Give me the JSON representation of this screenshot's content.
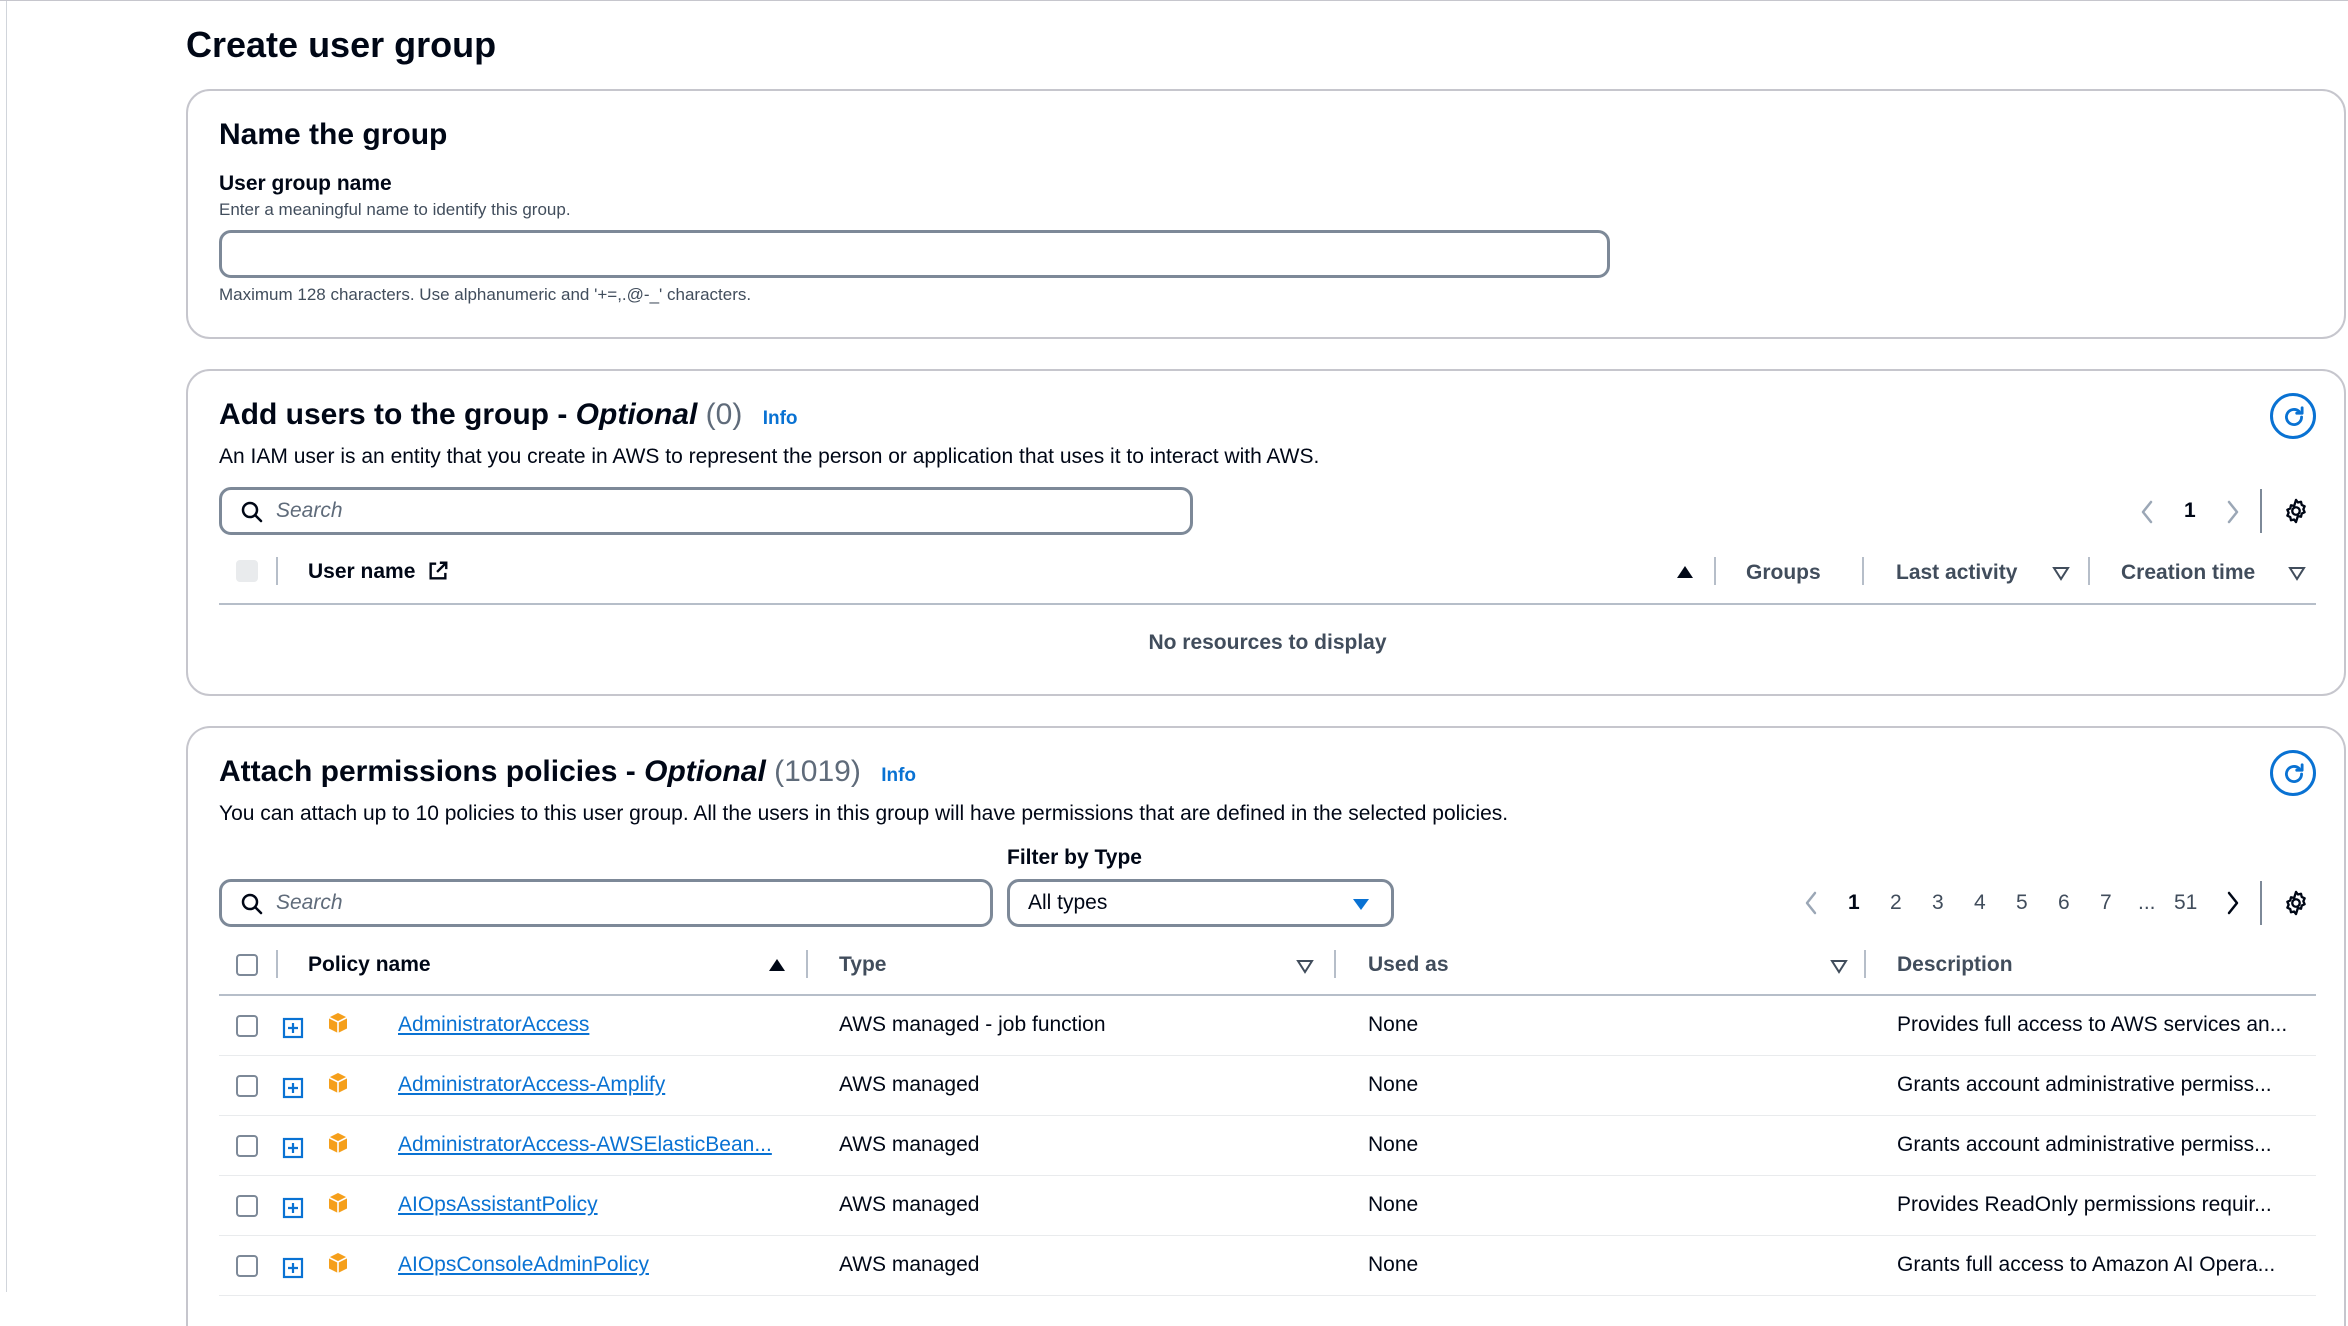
{
  "page_title": "Create user group",
  "name_section": {
    "title": "Name the group",
    "field_label": "User group name",
    "field_description": "Enter a meaningful name to identify this group.",
    "field_value": "",
    "constraint": "Maximum 128 characters. Use alphanumeric and '+=,.@-_' characters."
  },
  "users_section": {
    "title": "Add users to the group - ",
    "title_optional": "Optional",
    "count": "(0)",
    "info": "Info",
    "description": "An IAM user is an entity that you create in AWS to represent the person or application that uses it to interact with AWS.",
    "search_placeholder": "Search",
    "pagination": {
      "current": "1"
    },
    "columns": {
      "user_name": "User name",
      "groups": "Groups",
      "last_activity": "Last activity",
      "creation_time": "Creation time"
    },
    "empty_text": "No resources to display"
  },
  "policies_section": {
    "title": "Attach permissions policies - ",
    "title_optional": "Optional",
    "count": "(1019)",
    "info": "Info",
    "description": "You can attach up to 10 policies to this user group. All the users in this group will have permissions that are defined in the selected policies.",
    "search_placeholder": "Search",
    "filter_label": "Filter by Type",
    "filter_value": "All types",
    "pagination": {
      "pages": [
        "1",
        "2",
        "3",
        "4",
        "5",
        "6",
        "7"
      ],
      "ellipsis": "...",
      "last": "51",
      "current": "1"
    },
    "columns": {
      "policy_name": "Policy name",
      "type": "Type",
      "used_as": "Used as",
      "description": "Description"
    },
    "rows": [
      {
        "name": "AdministratorAccess",
        "type": "AWS managed - job function",
        "used_as": "None",
        "description": "Provides full access to AWS services an..."
      },
      {
        "name": "AdministratorAccess-Amplify",
        "type": "AWS managed",
        "used_as": "None",
        "description": "Grants account administrative permiss..."
      },
      {
        "name": "AdministratorAccess-AWSElasticBean...",
        "type": "AWS managed",
        "used_as": "None",
        "description": "Grants account administrative permiss..."
      },
      {
        "name": "AIOpsAssistantPolicy",
        "type": "AWS managed",
        "used_as": "None",
        "description": "Provides ReadOnly permissions requir..."
      },
      {
        "name": "AIOpsConsoleAdminPolicy",
        "type": "AWS managed",
        "used_as": "None",
        "description": "Grants full access to Amazon AI Opera..."
      }
    ]
  },
  "colors": {
    "link": "#0972d3",
    "border": "#7d8998",
    "text": "#000716",
    "policy_icon": "#f59f1b"
  },
  "icons": [
    "search-icon",
    "refresh-icon",
    "settings-gear-icon",
    "external-link-icon",
    "chevron-left-icon",
    "chevron-right-icon",
    "sort-ascending-icon",
    "sort-descending-icon",
    "dropdown-caret-icon",
    "expand-icon",
    "policy-package-icon"
  ]
}
